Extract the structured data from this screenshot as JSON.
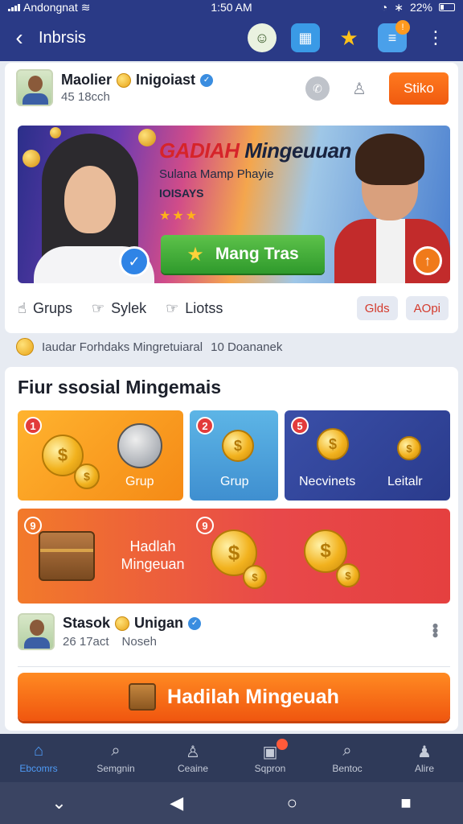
{
  "status_bar": {
    "carrier": "Andongnat",
    "time": "1:50 AM",
    "battery": "22%"
  },
  "app_bar": {
    "title": "Inbrsis",
    "notification_count": "!"
  },
  "profile": {
    "name": "Maolier",
    "tag": "Inigoiast",
    "sub": "45 18cch",
    "action_label": "Stiko"
  },
  "banner": {
    "title_red": "GADIAH",
    "title_dark": "Mingeuuan",
    "subtitle": "Sulana Mamp Phayie",
    "days": "IOISAYS",
    "stars": "★★★",
    "cta_label": "Mang Tras"
  },
  "tabs": [
    {
      "label": "Grups"
    },
    {
      "label": "Sylek"
    },
    {
      "label": "Liotss"
    }
  ],
  "chips": [
    "Glds",
    "AOpi"
  ],
  "info_line": {
    "text": "Iaudar Forhdaks Mingretuiaral",
    "count": "10 Doananek"
  },
  "section": {
    "heading": "Fiur ssosial Mingemais",
    "tiles": [
      {
        "num": "1",
        "label": "Grup"
      },
      {
        "num": "2",
        "label": "Grup"
      },
      {
        "num": "5",
        "label": "Necvinets",
        "label2": "Leitalr"
      },
      {
        "num": "9",
        "num2": "9",
        "label": "Hadlah Mingeuan"
      }
    ]
  },
  "user2": {
    "name": "Stasok",
    "tag": "Unigan",
    "sub1": "26 17act",
    "sub2": "Noseh"
  },
  "cta": {
    "label": "Hadilah Mingeuah"
  },
  "bottom_nav": [
    {
      "label": "Ebcomrs",
      "icon": "home-icon"
    },
    {
      "label": "Semgnin",
      "icon": "search-icon"
    },
    {
      "label": "Ceaine",
      "icon": "person-icon"
    },
    {
      "label": "Sqpron",
      "icon": "chat-icon"
    },
    {
      "label": "Bentoc",
      "icon": "search-icon"
    },
    {
      "label": "Alire",
      "icon": "user-icon"
    }
  ],
  "colors": {
    "primary": "#2a3a86",
    "accent": "#f05a10",
    "nav_active": "#4e9af5"
  }
}
